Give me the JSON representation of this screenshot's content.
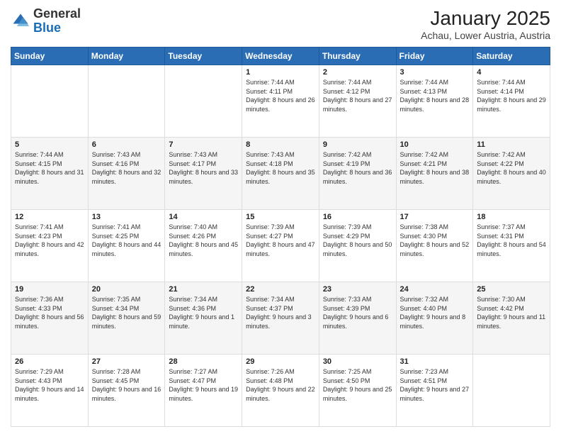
{
  "logo": {
    "general": "General",
    "blue": "Blue"
  },
  "header": {
    "title": "January 2025",
    "subtitle": "Achau, Lower Austria, Austria"
  },
  "weekdays": [
    "Sunday",
    "Monday",
    "Tuesday",
    "Wednesday",
    "Thursday",
    "Friday",
    "Saturday"
  ],
  "weeks": [
    [
      {
        "day": "",
        "sunrise": "",
        "sunset": "",
        "daylight": ""
      },
      {
        "day": "",
        "sunrise": "",
        "sunset": "",
        "daylight": ""
      },
      {
        "day": "",
        "sunrise": "",
        "sunset": "",
        "daylight": ""
      },
      {
        "day": "1",
        "sunrise": "Sunrise: 7:44 AM",
        "sunset": "Sunset: 4:11 PM",
        "daylight": "Daylight: 8 hours and 26 minutes."
      },
      {
        "day": "2",
        "sunrise": "Sunrise: 7:44 AM",
        "sunset": "Sunset: 4:12 PM",
        "daylight": "Daylight: 8 hours and 27 minutes."
      },
      {
        "day": "3",
        "sunrise": "Sunrise: 7:44 AM",
        "sunset": "Sunset: 4:13 PM",
        "daylight": "Daylight: 8 hours and 28 minutes."
      },
      {
        "day": "4",
        "sunrise": "Sunrise: 7:44 AM",
        "sunset": "Sunset: 4:14 PM",
        "daylight": "Daylight: 8 hours and 29 minutes."
      }
    ],
    [
      {
        "day": "5",
        "sunrise": "Sunrise: 7:44 AM",
        "sunset": "Sunset: 4:15 PM",
        "daylight": "Daylight: 8 hours and 31 minutes."
      },
      {
        "day": "6",
        "sunrise": "Sunrise: 7:43 AM",
        "sunset": "Sunset: 4:16 PM",
        "daylight": "Daylight: 8 hours and 32 minutes."
      },
      {
        "day": "7",
        "sunrise": "Sunrise: 7:43 AM",
        "sunset": "Sunset: 4:17 PM",
        "daylight": "Daylight: 8 hours and 33 minutes."
      },
      {
        "day": "8",
        "sunrise": "Sunrise: 7:43 AM",
        "sunset": "Sunset: 4:18 PM",
        "daylight": "Daylight: 8 hours and 35 minutes."
      },
      {
        "day": "9",
        "sunrise": "Sunrise: 7:42 AM",
        "sunset": "Sunset: 4:19 PM",
        "daylight": "Daylight: 8 hours and 36 minutes."
      },
      {
        "day": "10",
        "sunrise": "Sunrise: 7:42 AM",
        "sunset": "Sunset: 4:21 PM",
        "daylight": "Daylight: 8 hours and 38 minutes."
      },
      {
        "day": "11",
        "sunrise": "Sunrise: 7:42 AM",
        "sunset": "Sunset: 4:22 PM",
        "daylight": "Daylight: 8 hours and 40 minutes."
      }
    ],
    [
      {
        "day": "12",
        "sunrise": "Sunrise: 7:41 AM",
        "sunset": "Sunset: 4:23 PM",
        "daylight": "Daylight: 8 hours and 42 minutes."
      },
      {
        "day": "13",
        "sunrise": "Sunrise: 7:41 AM",
        "sunset": "Sunset: 4:25 PM",
        "daylight": "Daylight: 8 hours and 44 minutes."
      },
      {
        "day": "14",
        "sunrise": "Sunrise: 7:40 AM",
        "sunset": "Sunset: 4:26 PM",
        "daylight": "Daylight: 8 hours and 45 minutes."
      },
      {
        "day": "15",
        "sunrise": "Sunrise: 7:39 AM",
        "sunset": "Sunset: 4:27 PM",
        "daylight": "Daylight: 8 hours and 47 minutes."
      },
      {
        "day": "16",
        "sunrise": "Sunrise: 7:39 AM",
        "sunset": "Sunset: 4:29 PM",
        "daylight": "Daylight: 8 hours and 50 minutes."
      },
      {
        "day": "17",
        "sunrise": "Sunrise: 7:38 AM",
        "sunset": "Sunset: 4:30 PM",
        "daylight": "Daylight: 8 hours and 52 minutes."
      },
      {
        "day": "18",
        "sunrise": "Sunrise: 7:37 AM",
        "sunset": "Sunset: 4:31 PM",
        "daylight": "Daylight: 8 hours and 54 minutes."
      }
    ],
    [
      {
        "day": "19",
        "sunrise": "Sunrise: 7:36 AM",
        "sunset": "Sunset: 4:33 PM",
        "daylight": "Daylight: 8 hours and 56 minutes."
      },
      {
        "day": "20",
        "sunrise": "Sunrise: 7:35 AM",
        "sunset": "Sunset: 4:34 PM",
        "daylight": "Daylight: 8 hours and 59 minutes."
      },
      {
        "day": "21",
        "sunrise": "Sunrise: 7:34 AM",
        "sunset": "Sunset: 4:36 PM",
        "daylight": "Daylight: 9 hours and 1 minute."
      },
      {
        "day": "22",
        "sunrise": "Sunrise: 7:34 AM",
        "sunset": "Sunset: 4:37 PM",
        "daylight": "Daylight: 9 hours and 3 minutes."
      },
      {
        "day": "23",
        "sunrise": "Sunrise: 7:33 AM",
        "sunset": "Sunset: 4:39 PM",
        "daylight": "Daylight: 9 hours and 6 minutes."
      },
      {
        "day": "24",
        "sunrise": "Sunrise: 7:32 AM",
        "sunset": "Sunset: 4:40 PM",
        "daylight": "Daylight: 9 hours and 8 minutes."
      },
      {
        "day": "25",
        "sunrise": "Sunrise: 7:30 AM",
        "sunset": "Sunset: 4:42 PM",
        "daylight": "Daylight: 9 hours and 11 minutes."
      }
    ],
    [
      {
        "day": "26",
        "sunrise": "Sunrise: 7:29 AM",
        "sunset": "Sunset: 4:43 PM",
        "daylight": "Daylight: 9 hours and 14 minutes."
      },
      {
        "day": "27",
        "sunrise": "Sunrise: 7:28 AM",
        "sunset": "Sunset: 4:45 PM",
        "daylight": "Daylight: 9 hours and 16 minutes."
      },
      {
        "day": "28",
        "sunrise": "Sunrise: 7:27 AM",
        "sunset": "Sunset: 4:47 PM",
        "daylight": "Daylight: 9 hours and 19 minutes."
      },
      {
        "day": "29",
        "sunrise": "Sunrise: 7:26 AM",
        "sunset": "Sunset: 4:48 PM",
        "daylight": "Daylight: 9 hours and 22 minutes."
      },
      {
        "day": "30",
        "sunrise": "Sunrise: 7:25 AM",
        "sunset": "Sunset: 4:50 PM",
        "daylight": "Daylight: 9 hours and 25 minutes."
      },
      {
        "day": "31",
        "sunrise": "Sunrise: 7:23 AM",
        "sunset": "Sunset: 4:51 PM",
        "daylight": "Daylight: 9 hours and 27 minutes."
      },
      {
        "day": "",
        "sunrise": "",
        "sunset": "",
        "daylight": ""
      }
    ]
  ]
}
